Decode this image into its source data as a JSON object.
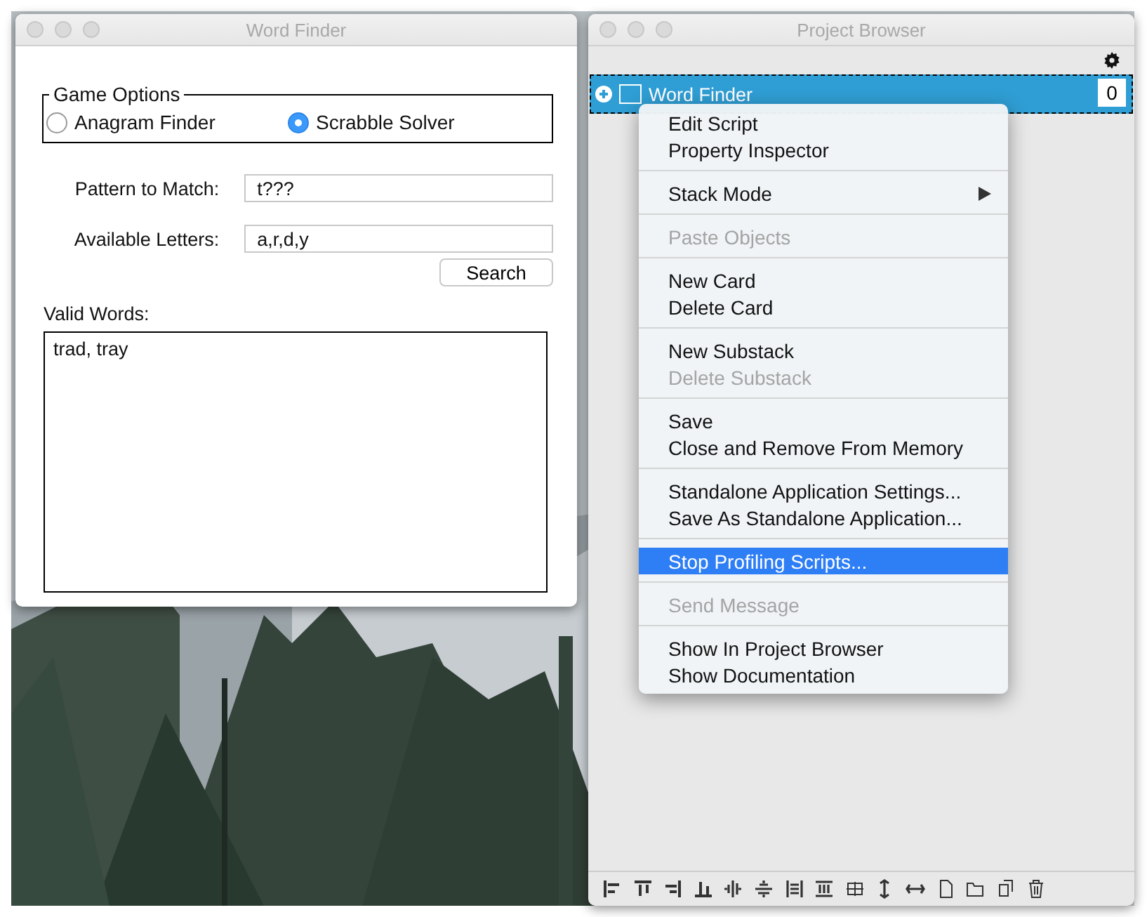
{
  "word_finder": {
    "title": "Word Finder",
    "game_options": {
      "legend": "Game Options",
      "options": [
        {
          "label": "Anagram Finder",
          "selected": false
        },
        {
          "label": "Scrabble Solver",
          "selected": true
        }
      ]
    },
    "fields": [
      {
        "label": "Pattern to Match:",
        "value": "t???"
      },
      {
        "label": "Available Letters:",
        "value": "a,r,d,y"
      }
    ],
    "search_button": "Search",
    "results_label": "Valid Words:",
    "results": "trad, tray"
  },
  "project_browser": {
    "title": "Project Browser",
    "stack_row": {
      "name": "Word Finder",
      "count": "0",
      "selected": true
    },
    "context_menu": [
      {
        "kind": "group",
        "items": [
          {
            "label": "Edit Script",
            "disabled": false,
            "selected": false,
            "submenu": false
          },
          {
            "label": "Property Inspector",
            "disabled": false,
            "selected": false,
            "submenu": false
          }
        ]
      },
      {
        "kind": "group",
        "items": [
          {
            "label": "Stack Mode",
            "disabled": false,
            "selected": false,
            "submenu": true
          }
        ]
      },
      {
        "kind": "group",
        "items": [
          {
            "label": "Paste Objects",
            "disabled": true,
            "selected": false,
            "submenu": false
          }
        ]
      },
      {
        "kind": "group",
        "items": [
          {
            "label": "New Card",
            "disabled": false,
            "selected": false,
            "submenu": false
          },
          {
            "label": "Delete Card",
            "disabled": false,
            "selected": false,
            "submenu": false
          }
        ]
      },
      {
        "kind": "group",
        "items": [
          {
            "label": "New Substack",
            "disabled": false,
            "selected": false,
            "submenu": false
          },
          {
            "label": "Delete Substack",
            "disabled": true,
            "selected": false,
            "submenu": false
          }
        ]
      },
      {
        "kind": "group",
        "items": [
          {
            "label": "Save",
            "disabled": false,
            "selected": false,
            "submenu": false
          },
          {
            "label": "Close and Remove From Memory",
            "disabled": false,
            "selected": false,
            "submenu": false
          }
        ]
      },
      {
        "kind": "group",
        "items": [
          {
            "label": "Standalone Application Settings...",
            "disabled": false,
            "selected": false,
            "submenu": false
          },
          {
            "label": "Save As Standalone Application...",
            "disabled": false,
            "selected": false,
            "submenu": false
          }
        ]
      },
      {
        "kind": "group",
        "items": [
          {
            "label": "Stop Profiling Scripts...",
            "disabled": false,
            "selected": true,
            "submenu": false
          }
        ]
      },
      {
        "kind": "group",
        "items": [
          {
            "label": "Send Message",
            "disabled": true,
            "selected": false,
            "submenu": false
          }
        ]
      },
      {
        "kind": "group",
        "items": [
          {
            "label": "Show In Project Browser",
            "disabled": false,
            "selected": false,
            "submenu": false
          },
          {
            "label": "Show Documentation",
            "disabled": false,
            "selected": false,
            "submenu": false
          }
        ]
      }
    ]
  }
}
